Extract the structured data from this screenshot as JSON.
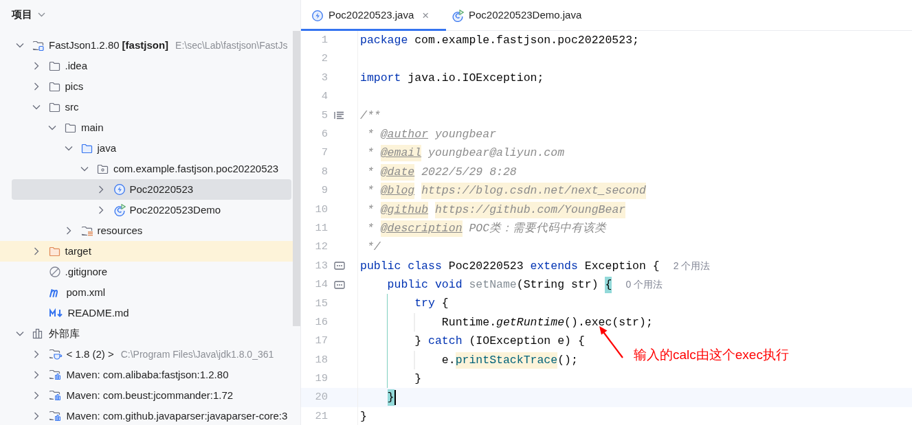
{
  "project_panel": {
    "title": "项目",
    "tree": [
      {
        "kind": "module",
        "label": "FastJson1.2.80",
        "bold_label": "[fastjson]",
        "detail": "E:\\sec\\Lab\\fastjson\\FastJs",
        "expanded": true,
        "selected": false,
        "children": [
          {
            "kind": "folder",
            "label": ".idea",
            "expanded": false,
            "selected": false
          },
          {
            "kind": "folder",
            "label": "pics",
            "expanded": false,
            "selected": false
          },
          {
            "kind": "folder",
            "label": "src",
            "expanded": true,
            "selected": false,
            "children": [
              {
                "kind": "folder",
                "label": "main",
                "expanded": true,
                "selected": false,
                "children": [
                  {
                    "kind": "source-folder",
                    "label": "java",
                    "expanded": true,
                    "selected": false,
                    "children": [
                      {
                        "kind": "package",
                        "label": "com.example.fastjson.poc20220523",
                        "expanded": true,
                        "selected": false,
                        "children": [
                          {
                            "kind": "exception-class",
                            "label": "Poc20220523",
                            "expanded": false,
                            "selected": true
                          },
                          {
                            "kind": "runnable-class",
                            "label": "Poc20220523Demo",
                            "expanded": false,
                            "selected": false
                          }
                        ]
                      }
                    ]
                  },
                  {
                    "kind": "resources",
                    "label": "resources",
                    "expanded": false,
                    "selected": false
                  }
                ]
              }
            ]
          },
          {
            "kind": "excluded-folder",
            "label": "target",
            "expanded": false,
            "selected": false
          },
          {
            "kind": "ignore-file",
            "label": ".gitignore",
            "selected": false
          },
          {
            "kind": "maven-file",
            "label": "pom.xml",
            "selected": false
          },
          {
            "kind": "markdown-file",
            "label": "README.md",
            "selected": false
          }
        ]
      },
      {
        "kind": "libraries",
        "label": "外部库",
        "expanded": true,
        "selected": false,
        "children": [
          {
            "kind": "jdk",
            "label": "< 1.8 (2) >",
            "detail": "C:\\Program Files\\Java\\jdk1.8.0_361",
            "expanded": false,
            "selected": false
          },
          {
            "kind": "library",
            "label": "Maven: com.alibaba:fastjson:1.2.80",
            "expanded": false,
            "selected": false
          },
          {
            "kind": "library",
            "label": "Maven: com.beust:jcommander:1.72",
            "expanded": false,
            "selected": false
          },
          {
            "kind": "library",
            "label": "Maven: com.github.javaparser:javaparser-core:3",
            "expanded": false,
            "selected": false
          }
        ]
      }
    ]
  },
  "editor": {
    "tabs": [
      {
        "kind": "exception-class",
        "label": "Poc20220523.java",
        "close": "×",
        "selected": true
      },
      {
        "kind": "runnable-class",
        "label": "Poc20220523Demo.java",
        "selected": false
      }
    ],
    "lines": [
      {
        "number": "1",
        "kind": "code",
        "current": false,
        "tokens": [
          {
            "kind": "kw",
            "text": "package"
          },
          {
            "kind": "text",
            "text": " com.example.fastjson.poc20220523;"
          }
        ]
      },
      {
        "number": "2",
        "kind": "code",
        "current": false
      },
      {
        "number": "3",
        "kind": "code",
        "current": false,
        "tokens": [
          {
            "kind": "kw",
            "text": "import"
          },
          {
            "kind": "text",
            "text": " java.io.IOException;"
          }
        ]
      },
      {
        "number": "4",
        "kind": "code",
        "current": false
      },
      {
        "number": "5",
        "kind": "doc-start",
        "current": false,
        "tokens": [
          {
            "kind": "doc",
            "text": "/**"
          }
        ]
      },
      {
        "number": "6",
        "kind": "code",
        "current": false,
        "tokens": [
          {
            "kind": "doc",
            "text": " *"
          },
          {
            "kind": "doc-tag",
            "text": " @author"
          },
          {
            "kind": "doc",
            "text": " youngbear"
          }
        ]
      },
      {
        "number": "7",
        "kind": "code",
        "current": false,
        "tokens": [
          {
            "kind": "doc",
            "text": " *"
          },
          {
            "kind": "doc-tag-hl",
            "text": " @email"
          },
          {
            "kind": "doc",
            "text": " youngbear@aliyun.com"
          }
        ]
      },
      {
        "number": "8",
        "kind": "code",
        "current": false,
        "tokens": [
          {
            "kind": "doc",
            "text": " *"
          },
          {
            "kind": "doc-tag-hl",
            "text": " @date"
          },
          {
            "kind": "doc",
            "text": " 2022/5/29 8:28"
          }
        ]
      },
      {
        "number": "9",
        "kind": "code",
        "current": false,
        "tokens": [
          {
            "kind": "doc",
            "text": " *"
          },
          {
            "kind": "doc-tag-hl",
            "text": " @blog"
          },
          {
            "kind": "doc-hl",
            "text": " https://blog.csdn.net/next_second"
          }
        ]
      },
      {
        "number": "10",
        "kind": "code",
        "current": false,
        "tokens": [
          {
            "kind": "doc",
            "text": " *"
          },
          {
            "kind": "doc-tag-hl",
            "text": " @github"
          },
          {
            "kind": "doc-hl",
            "text": " https://github.com/YoungBear"
          }
        ]
      },
      {
        "number": "11",
        "kind": "code",
        "current": false,
        "tokens": [
          {
            "kind": "doc",
            "text": " *"
          },
          {
            "kind": "doc-tag-hl",
            "text": " @description"
          },
          {
            "kind": "doc",
            "text": " POC类：需要代码中有该类"
          }
        ]
      },
      {
        "number": "12",
        "kind": "code",
        "current": false,
        "tokens": [
          {
            "kind": "doc",
            "text": " */"
          }
        ]
      },
      {
        "number": "13",
        "kind": "declaration",
        "current": false,
        "tokens": [
          {
            "kind": "kw",
            "text": "public class"
          },
          {
            "kind": "text",
            "text": " Poc20220523"
          },
          {
            "kind": "kw",
            "text": " extends"
          },
          {
            "kind": "text",
            "text": " Exception {"
          },
          {
            "kind": "hint",
            "text": "2 个用法"
          }
        ]
      },
      {
        "number": "14",
        "kind": "declaration",
        "current": false,
        "tokens": [
          {
            "kind": "kw",
            "text": "    public void"
          },
          {
            "kind": "method",
            "text": " setName"
          },
          {
            "kind": "text",
            "text": "(String str)"
          },
          {
            "kind": "brace-hl",
            "text": " {"
          },
          {
            "kind": "hint",
            "text": "0 个用法"
          }
        ]
      },
      {
        "number": "15",
        "kind": "code",
        "current": false,
        "tokens": [
          {
            "kind": "kw",
            "text": "        try"
          },
          {
            "kind": "text",
            "text": " {"
          }
        ]
      },
      {
        "number": "16",
        "kind": "code",
        "current": false,
        "tokens": [
          {
            "kind": "text",
            "text": "            Runtime."
          },
          {
            "kind": "static-call",
            "text": "getRuntime"
          },
          {
            "kind": "text",
            "text": "().exec(str);"
          }
        ]
      },
      {
        "number": "17",
        "kind": "code",
        "current": false,
        "tokens": [
          {
            "kind": "text",
            "text": "        }"
          },
          {
            "kind": "kw",
            "text": " catch"
          },
          {
            "kind": "text",
            "text": " (IOException e) {"
          }
        ]
      },
      {
        "number": "18",
        "kind": "code",
        "current": false,
        "tokens": [
          {
            "kind": "text",
            "text": "            e."
          },
          {
            "kind": "method-hl",
            "text": "printStackTrace"
          },
          {
            "kind": "text",
            "text": "();"
          }
        ]
      },
      {
        "number": "19",
        "kind": "code",
        "current": false,
        "tokens": [
          {
            "kind": "text",
            "text": "        }"
          }
        ]
      },
      {
        "number": "20",
        "kind": "code",
        "current": true,
        "tokens": [
          {
            "kind": "brace-hl",
            "text": "    }"
          }
        ]
      },
      {
        "number": "21",
        "kind": "code",
        "current": false,
        "tokens": [
          {
            "kind": "text",
            "text": "}"
          }
        ]
      }
    ],
    "annotation": {
      "text": "输入的calc由这个exec执行"
    }
  }
}
